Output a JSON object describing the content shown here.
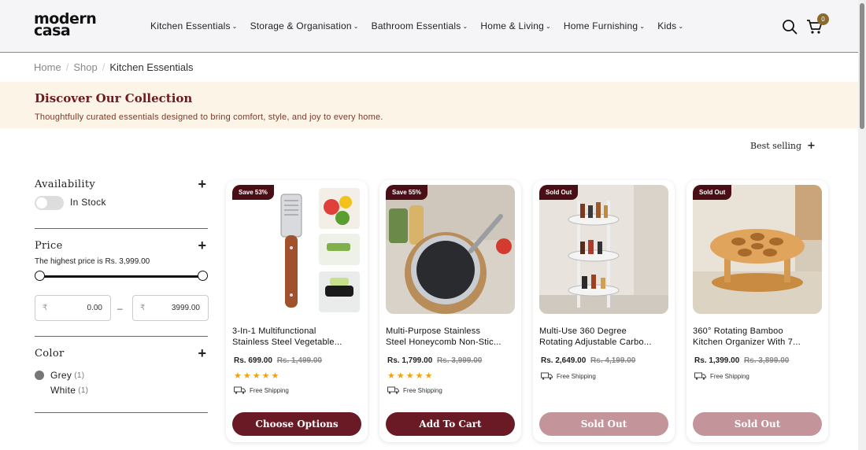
{
  "header": {
    "logo_line1": "modern",
    "logo_line2": "casa",
    "nav": [
      {
        "label": "Kitchen Essentials"
      },
      {
        "label": "Storage & Organisation"
      },
      {
        "label": "Bathroom Essentials"
      },
      {
        "label": "Home & Living"
      },
      {
        "label": "Home Furnishing"
      },
      {
        "label": "Kids"
      }
    ],
    "cart_count": "0"
  },
  "breadcrumb": {
    "items": [
      "Home",
      "Shop",
      "Kitchen Essentials"
    ],
    "separator": "/"
  },
  "banner": {
    "title": "Discover Our Collection",
    "subtitle": "Thoughtfully curated essentials designed to bring comfort, style, and joy to every home."
  },
  "sort": {
    "label": "Best selling",
    "icon": "+"
  },
  "filters": {
    "availability": {
      "title": "Availability",
      "option": "In Stock"
    },
    "price": {
      "title": "Price",
      "note": "The highest price is Rs. 3,999.00",
      "currency": "₹",
      "min_value": "0.00",
      "max_value": "3999.00",
      "dash": "–"
    },
    "color": {
      "title": "Color",
      "options": [
        {
          "label": "Grey",
          "count": "(1)",
          "swatch": "#777777"
        },
        {
          "label": "White",
          "count": "(1)"
        }
      ]
    },
    "expand_icon": "+"
  },
  "products": [
    {
      "badge": "Save 53%",
      "title_line1": "3-In-1 Multifunctional",
      "title_line2": "Stainless Steel Vegetable...",
      "price": "Rs. 699.00",
      "old_price": "Rs. 1,499.00",
      "stars": "★★★★★",
      "shipping": "Free Shipping",
      "button": "Choose Options",
      "sold_out": false
    },
    {
      "badge": "Save 55%",
      "title_line1": "Multi-Purpose Stainless",
      "title_line2": "Steel Honeycomb Non-Stic...",
      "price": "Rs. 1,799.00",
      "old_price": "Rs. 3,999.00",
      "stars": "★★★★★",
      "shipping": "Free Shipping",
      "button": "Add To Cart",
      "sold_out": false
    },
    {
      "badge": "Sold Out",
      "title_line1": "Multi-Use 360 Degree",
      "title_line2": "Rotating Adjustable Carbo...",
      "price": "Rs. 2,649.00",
      "old_price": "Rs. 4,199.00",
      "stars": "",
      "shipping": "Free Shipping",
      "button": "Sold Out",
      "sold_out": true
    },
    {
      "badge": "Sold Out",
      "title_line1": "360° Rotating Bamboo",
      "title_line2": "Kitchen Organizer With 7...",
      "price": "Rs. 1,399.00",
      "old_price": "Rs. 3,899.00",
      "stars": "",
      "shipping": "Free Shipping",
      "button": "Sold Out",
      "sold_out": true
    }
  ],
  "colors": {
    "accent": "#6a1a24",
    "sold_out": "#c4949b",
    "banner_bg": "#fcf4e6",
    "badge_bg": "#4a0f16",
    "star": "#f3a20f",
    "cart_badge": "#8b6a2e"
  }
}
